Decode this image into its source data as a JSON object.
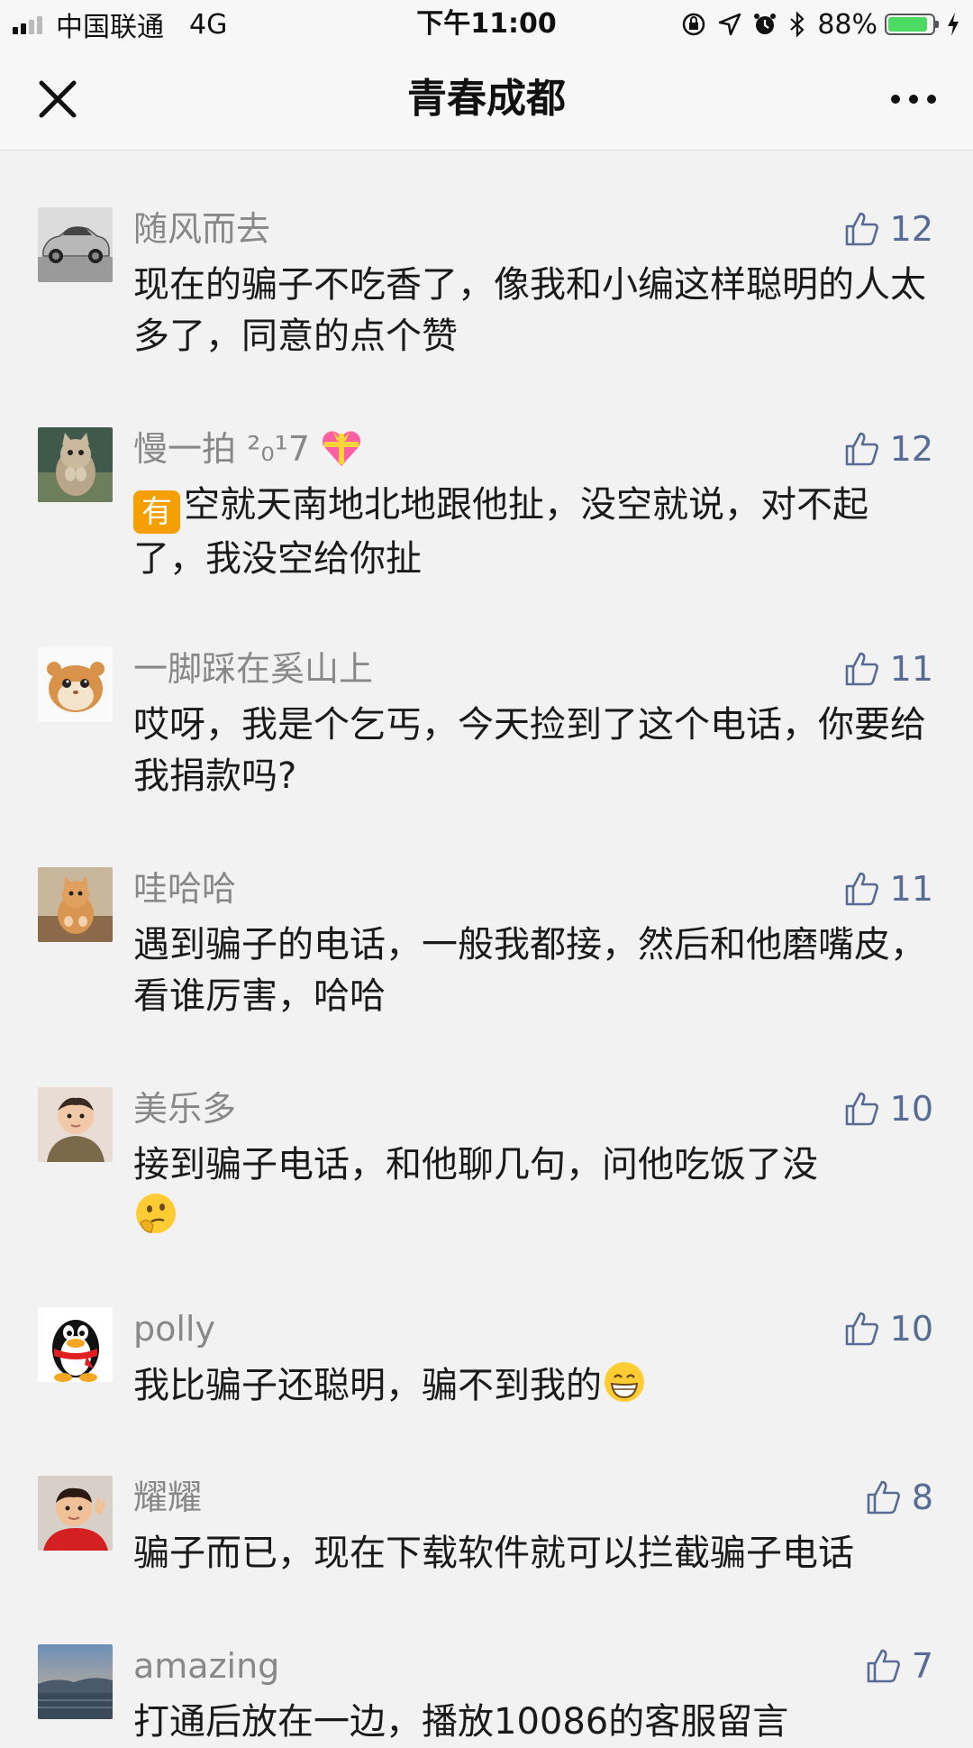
{
  "status_bar": {
    "carrier": "中国联通",
    "network": "4G",
    "time": "下午11:00",
    "battery": "88%"
  },
  "nav": {
    "title": "青春成都"
  },
  "colors": {
    "like_blue": "#576b95",
    "name_gray": "#888888",
    "background": "#f2f2f2"
  },
  "comments": [
    {
      "name": "随风而去",
      "likes": "12",
      "text": "现在的骗子不吃香了，像我和小编这样聪明的人太多了，同意的点个赞",
      "avatar": "car-avatar"
    },
    {
      "name": "慢一拍 ²₀¹7",
      "likes": "12",
      "text_prefix_icon": "有",
      "text": "空就天南地北地跟他扯，没空就说，对不起了，我没空给你扯",
      "avatar": "kitten-avatar"
    },
    {
      "name": "一脚踩在奚山上",
      "likes": "11",
      "text": "哎呀，我是个乞丐，今天捡到了这个电话，你要给我捐款吗?",
      "avatar": "hamster-avatar"
    },
    {
      "name": "哇哈哈",
      "likes": "11",
      "text": "遇到骗子的电话，一般我都接，然后和他磨嘴皮，看谁厉害，哈哈",
      "avatar": "cat-avatar"
    },
    {
      "name": "美乐多",
      "likes": "10",
      "text": "接到骗子电话，和他聊几句，问他吃饭了没",
      "avatar": "baby-avatar"
    },
    {
      "name": "polly",
      "likes": "10",
      "text": "我比骗子还聪明，骗不到我的",
      "avatar": "penguin-avatar"
    },
    {
      "name": "耀耀",
      "likes": "8",
      "text": "骗子而已，现在下载软件就可以拦截骗子电话",
      "avatar": "child-avatar"
    },
    {
      "name": "amazing",
      "likes": "7",
      "text": "打通后放在一边，播放10086的客服留言",
      "avatar": "landscape-avatar"
    }
  ]
}
